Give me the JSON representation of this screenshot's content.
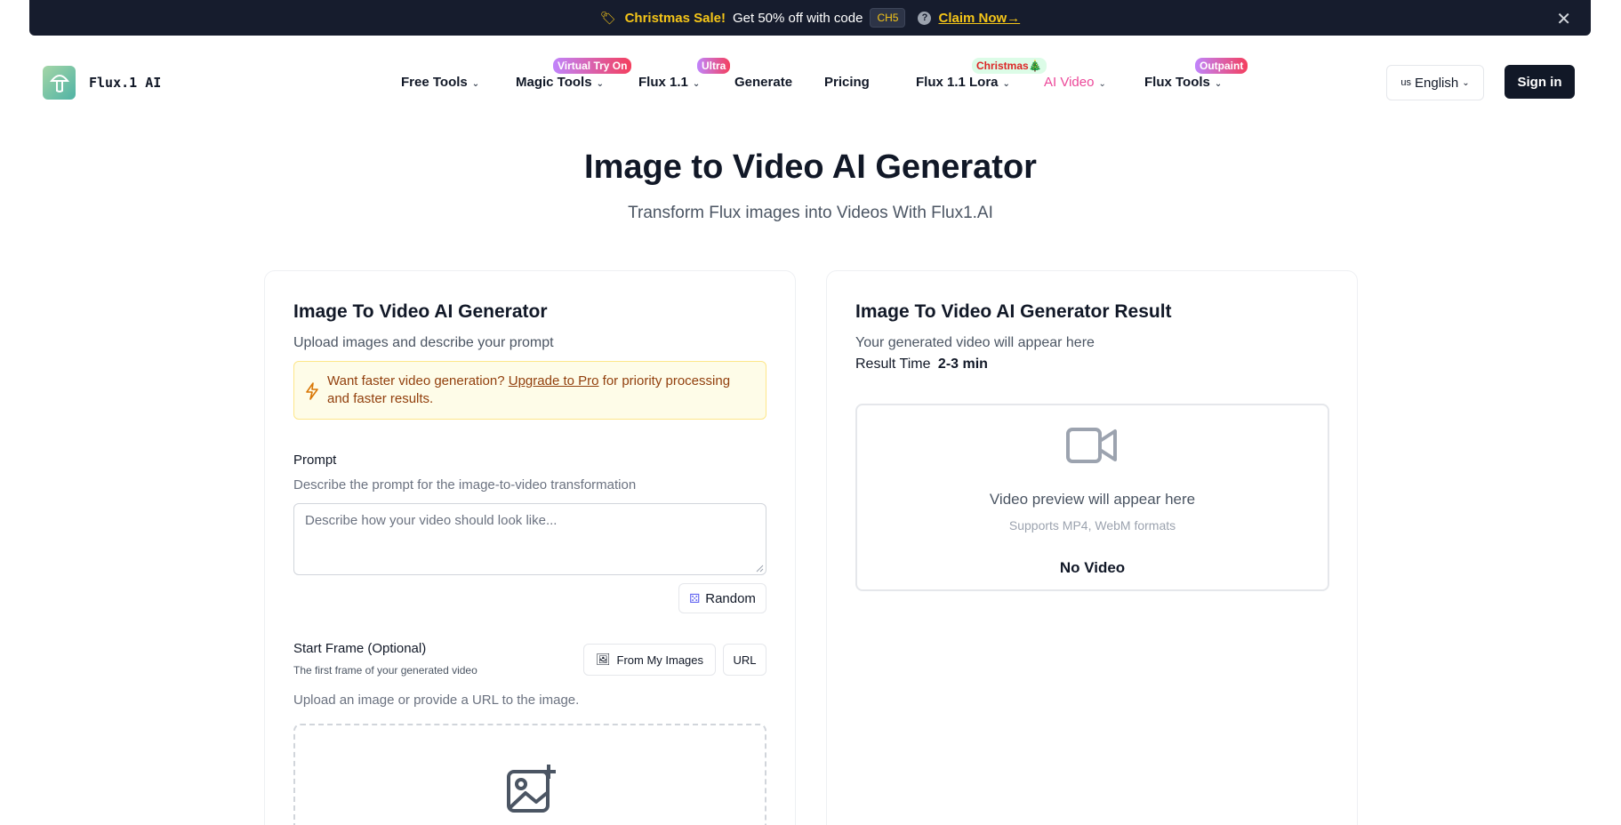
{
  "promo": {
    "icon": "tag-icon",
    "sale": "Christmas Sale!",
    "text": "Get 50% off with code",
    "code": "CH5",
    "claim": "Claim Now→",
    "close": "✕"
  },
  "nav": {
    "logo_text": "Flux.1 AI",
    "items": [
      {
        "label": "Free Tools",
        "badge": ""
      },
      {
        "label": "Magic Tools",
        "badge": "Virtual Try On"
      },
      {
        "label": "Flux 1.1",
        "badge": "Ultra"
      },
      {
        "label": "Generate",
        "badge": ""
      },
      {
        "label": "Pricing",
        "badge": ""
      },
      {
        "label": "Flux 1.1 Lora",
        "badge": "Christmas🎄"
      },
      {
        "label": "AI Video",
        "badge": ""
      },
      {
        "label": "Flux Tools",
        "badge": "Outpaint"
      }
    ],
    "language_flag": "us",
    "language": "English",
    "signin": "Sign in",
    "colors": {
      "active": "#ec4899",
      "badge_gradient": [
        "#c084fc",
        "#f43f5e"
      ],
      "christmas_badge": "#dcfce7"
    }
  },
  "hero": {
    "title": "Image to Video AI Generator",
    "subtitle": "Transform Flux images into Videos With Flux1.AI"
  },
  "left_card": {
    "title": "Image To Video AI Generator",
    "subtitle": "Upload images and describe your prompt",
    "notice": {
      "icon": "lightning-icon",
      "before": "Want faster video generation?",
      "link": "Upgrade to Pro",
      "after": "for priority processing and faster results."
    },
    "prompt_label": "Prompt",
    "prompt_hint": "Describe the prompt for the image-to-video transformation",
    "prompt_placeholder": "Describe how your video should look like...",
    "random_button": "Random",
    "start_frame_label": "Start Frame (Optional)",
    "start_frame_hint": "The first frame of your generated video",
    "from_images_button": "From My Images",
    "url_button": "URL",
    "upload_hint": "Upload an image or provide a URL to the image."
  },
  "right_card": {
    "title": "Image To Video AI Generator Result",
    "subtitle": "Your generated video will appear here",
    "result_time_label": "Result Time",
    "result_time_value": "2-3 min",
    "preview_title": "Video preview will appear here",
    "preview_formats": "Supports MP4, WebM formats",
    "preview_status": "No Video"
  }
}
